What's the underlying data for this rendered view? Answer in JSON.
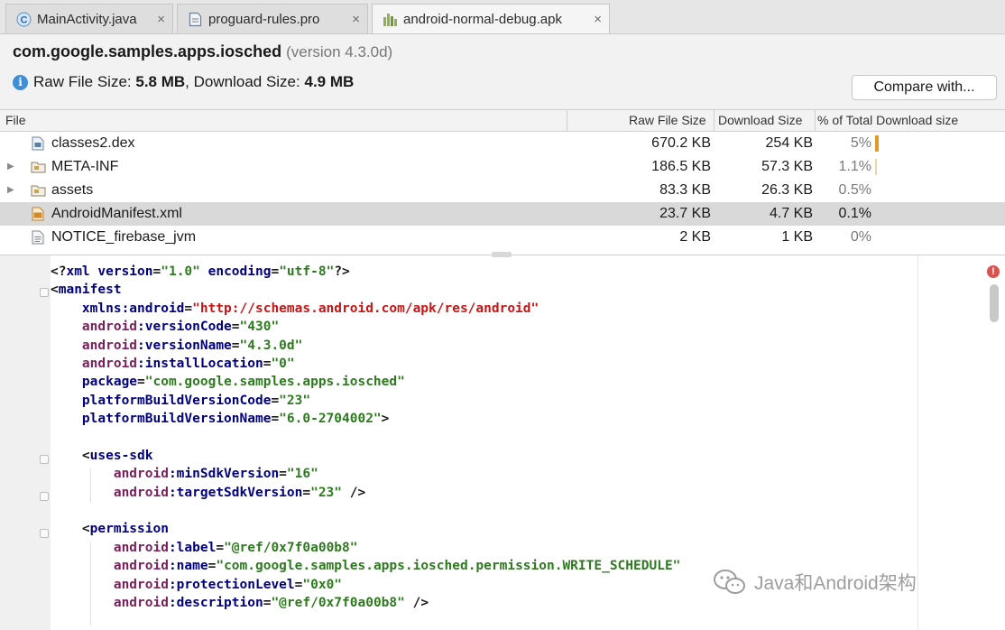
{
  "tabs": [
    {
      "label": "MainActivity.java",
      "icon": "java-class-icon"
    },
    {
      "label": "proguard-rules.pro",
      "icon": "file-icon"
    },
    {
      "label": "android-normal-debug.apk",
      "icon": "apk-icon",
      "active": true
    }
  ],
  "header": {
    "package": "com.google.samples.apps.iosched",
    "version_text": "(version 4.3.0d)",
    "raw_size_label": "Raw File Size:",
    "raw_size_value": "5.8 MB",
    "download_size_label": ", Download Size:",
    "download_size_value": "4.9 MB",
    "compare_label": "Compare with..."
  },
  "table": {
    "columns": [
      "File",
      "Raw File Size",
      "Download Size",
      "% of Total Download size"
    ],
    "rows": [
      {
        "name": "classes2.dex",
        "raw": "670.2 KB",
        "download": "254 KB",
        "percent": "5%",
        "percent_value": 5,
        "icon": "dex-file-icon",
        "expandable": false
      },
      {
        "name": "META-INF",
        "raw": "186.5 KB",
        "download": "57.3 KB",
        "percent": "1.1%",
        "percent_value": 1.1,
        "icon": "folder-icon",
        "expandable": true
      },
      {
        "name": "assets",
        "raw": "83.3 KB",
        "download": "26.3 KB",
        "percent": "0.5%",
        "percent_value": 0.5,
        "icon": "folder-icon",
        "expandable": true
      },
      {
        "name": "AndroidManifest.xml",
        "raw": "23.7 KB",
        "download": "4.7 KB",
        "percent": "0.1%",
        "percent_value": 0.1,
        "icon": "xml-file-icon",
        "expandable": false,
        "selected": true
      },
      {
        "name": "NOTICE_firebase_jvm",
        "raw": "2 KB",
        "download": "1 KB",
        "percent": "0%",
        "percent_value": 0,
        "icon": "text-file-icon",
        "expandable": false
      }
    ]
  },
  "editor": {
    "lines": [
      [
        {
          "t": "<?",
          "c": "p"
        },
        {
          "t": "xml ",
          "c": "k"
        },
        {
          "t": "version",
          "c": "k"
        },
        {
          "t": "=",
          "c": "p"
        },
        {
          "t": "\"1.0\"",
          "c": "v"
        },
        {
          "t": " encoding",
          "c": "k"
        },
        {
          "t": "=",
          "c": "p"
        },
        {
          "t": "\"utf-8\"",
          "c": "v"
        },
        {
          "t": "?>",
          "c": "p"
        }
      ],
      [
        {
          "t": "<",
          "c": "p"
        },
        {
          "t": "manifest",
          "c": "k"
        }
      ],
      [
        {
          "t": "    xmlns:android",
          "c": "k"
        },
        {
          "t": "=",
          "c": "p"
        },
        {
          "t": "\"http://schemas.android.com/apk/res/android\"",
          "c": "u"
        }
      ],
      [
        {
          "t": "    android",
          "c": "a"
        },
        {
          "t": ":versionCode",
          "c": "k"
        },
        {
          "t": "=",
          "c": "p"
        },
        {
          "t": "\"430\"",
          "c": "v"
        }
      ],
      [
        {
          "t": "    android",
          "c": "a"
        },
        {
          "t": ":versionName",
          "c": "k"
        },
        {
          "t": "=",
          "c": "p"
        },
        {
          "t": "\"4.3.0d\"",
          "c": "v"
        }
      ],
      [
        {
          "t": "    android",
          "c": "a"
        },
        {
          "t": ":installLocation",
          "c": "k"
        },
        {
          "t": "=",
          "c": "p"
        },
        {
          "t": "\"0\"",
          "c": "v"
        }
      ],
      [
        {
          "t": "    package",
          "c": "k"
        },
        {
          "t": "=",
          "c": "p"
        },
        {
          "t": "\"com.google.samples.apps.iosched\"",
          "c": "v"
        }
      ],
      [
        {
          "t": "    platformBuildVersionCode",
          "c": "k"
        },
        {
          "t": "=",
          "c": "p"
        },
        {
          "t": "\"23\"",
          "c": "v"
        }
      ],
      [
        {
          "t": "    platformBuildVersionName",
          "c": "k"
        },
        {
          "t": "=",
          "c": "p"
        },
        {
          "t": "\"6.0-2704002\"",
          "c": "v"
        },
        {
          "t": ">",
          "c": "p"
        }
      ],
      [],
      [
        {
          "t": "    <",
          "c": "p"
        },
        {
          "t": "uses-sdk",
          "c": "k"
        }
      ],
      [
        {
          "t": "        android",
          "c": "a"
        },
        {
          "t": ":minSdkVersion",
          "c": "k"
        },
        {
          "t": "=",
          "c": "p"
        },
        {
          "t": "\"16\"",
          "c": "v"
        }
      ],
      [
        {
          "t": "        android",
          "c": "a"
        },
        {
          "t": ":targetSdkVersion",
          "c": "k"
        },
        {
          "t": "=",
          "c": "p"
        },
        {
          "t": "\"23\"",
          "c": "v"
        },
        {
          "t": " />",
          "c": "p"
        }
      ],
      [],
      [
        {
          "t": "    <",
          "c": "p"
        },
        {
          "t": "permission",
          "c": "k"
        }
      ],
      [
        {
          "t": "        android",
          "c": "a"
        },
        {
          "t": ":label",
          "c": "k"
        },
        {
          "t": "=",
          "c": "p"
        },
        {
          "t": "\"@ref/0x7f0a00b8\"",
          "c": "v"
        }
      ],
      [
        {
          "t": "        android",
          "c": "a"
        },
        {
          "t": ":name",
          "c": "k"
        },
        {
          "t": "=",
          "c": "p"
        },
        {
          "t": "\"com.google.samples.apps.iosched.permission.WRITE_SCHEDULE\"",
          "c": "v"
        }
      ],
      [
        {
          "t": "        android",
          "c": "a"
        },
        {
          "t": ":protectionLevel",
          "c": "k"
        },
        {
          "t": "=",
          "c": "p"
        },
        {
          "t": "\"0x0\"",
          "c": "v"
        }
      ],
      [
        {
          "t": "        android",
          "c": "a"
        },
        {
          "t": ":description",
          "c": "k"
        },
        {
          "t": "=",
          "c": "p"
        },
        {
          "t": "\"@ref/0x7f0a00b8\"",
          "c": "v"
        },
        {
          "t": " />",
          "c": "p"
        }
      ]
    ]
  },
  "watermark": {
    "text": "Java和Android架构",
    "icon": "wechat-icon"
  },
  "colors": {
    "accent_bar": "#e39a25",
    "selection": "#d9d9d9",
    "info": "#3f8fd8"
  }
}
